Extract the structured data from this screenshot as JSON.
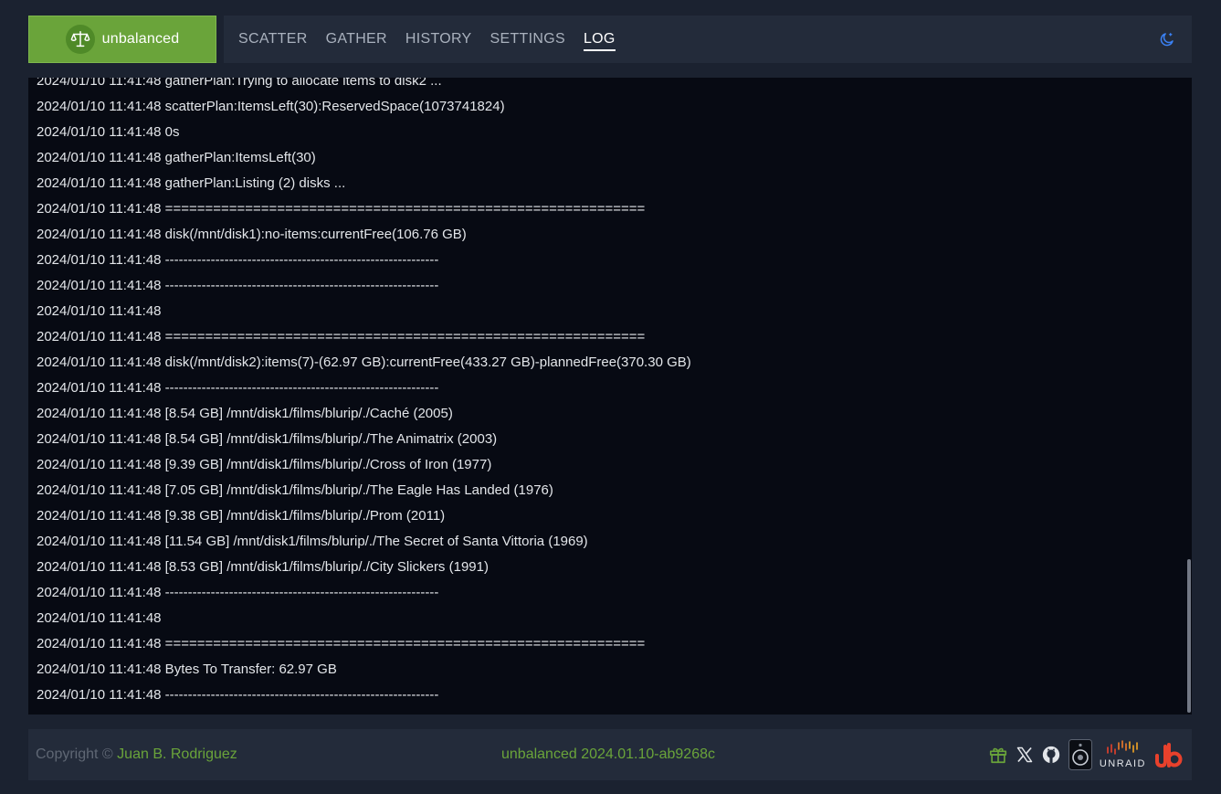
{
  "header": {
    "brand": "unbalanced",
    "nav": [
      {
        "label": "SCATTER",
        "active": false
      },
      {
        "label": "GATHER",
        "active": false
      },
      {
        "label": "HISTORY",
        "active": false
      },
      {
        "label": "SETTINGS",
        "active": false
      },
      {
        "label": "LOG",
        "active": true
      }
    ],
    "theme_icon": "moon-icon"
  },
  "log": {
    "lines": [
      "2024/01/10 11:41:48 gatherPlan:Trying to allocate items to disk2 ...",
      "2024/01/10 11:41:48 scatterPlan:ItemsLeft(30):ReservedSpace(1073741824)",
      "2024/01/10 11:41:48 0s",
      "2024/01/10 11:41:48 gatherPlan:ItemsLeft(30)",
      "2024/01/10 11:41:48 gatherPlan:Listing (2) disks ...",
      "2024/01/10 11:41:48 ============================================================",
      "2024/01/10 11:41:48 disk(/mnt/disk1):no-items:currentFree(106.76 GB)",
      "2024/01/10 11:41:48 ------------------------------------------------------------",
      "2024/01/10 11:41:48 ------------------------------------------------------------",
      "2024/01/10 11:41:48",
      "2024/01/10 11:41:48 ============================================================",
      "2024/01/10 11:41:48 disk(/mnt/disk2):items(7)-(62.97 GB):currentFree(433.27 GB)-plannedFree(370.30 GB)",
      "2024/01/10 11:41:48 ------------------------------------------------------------",
      "2024/01/10 11:41:48 [8.54 GB] /mnt/disk1/films/blurip/./Caché (2005)",
      "2024/01/10 11:41:48 [8.54 GB] /mnt/disk1/films/blurip/./The Animatrix (2003)",
      "2024/01/10 11:41:48 [9.39 GB] /mnt/disk1/films/blurip/./Cross of Iron (1977)",
      "2024/01/10 11:41:48 [7.05 GB] /mnt/disk1/films/blurip/./The Eagle Has Landed (1976)",
      "2024/01/10 11:41:48 [9.38 GB] /mnt/disk1/films/blurip/./Prom (2011)",
      "2024/01/10 11:41:48 [11.54 GB] /mnt/disk1/films/blurip/./The Secret of Santa Vittoria (1969)",
      "2024/01/10 11:41:48 [8.53 GB] /mnt/disk1/films/blurip/./City Slickers (1991)",
      "2024/01/10 11:41:48 ------------------------------------------------------------",
      "2024/01/10 11:41:48",
      "2024/01/10 11:41:48 ============================================================",
      "2024/01/10 11:41:48 Bytes To Transfer: 62.97 GB",
      "2024/01/10 11:41:48 ------------------------------------------------------------"
    ]
  },
  "footer": {
    "copyright_prefix": "Copyright ©",
    "author": "Juan B. Rodriguez",
    "version": "unbalanced 2024.01.10-ab9268c",
    "unraid_label": "UNRAID",
    "icons": [
      "gift-icon",
      "x-icon",
      "github-icon",
      "speaker-icon",
      "unraid-icon",
      "jb-logo-icon"
    ]
  },
  "colors": {
    "accent": "#6aa43a",
    "background": "#1b2230",
    "panel": "#232b3a",
    "log_background": "#070a13",
    "active_theme_icon": "#3b82f6",
    "logo_red": "#e8412c"
  }
}
